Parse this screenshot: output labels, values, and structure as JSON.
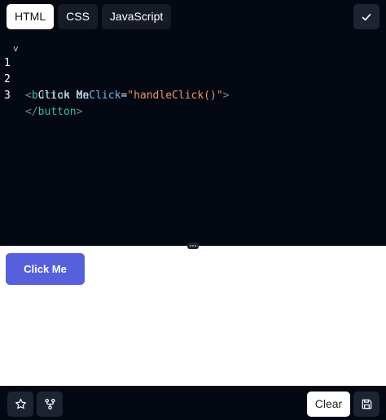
{
  "tabs": [
    {
      "label": "HTML",
      "active": true
    },
    {
      "label": "CSS",
      "active": false
    },
    {
      "label": "JavaScript",
      "active": false
    }
  ],
  "editor": {
    "lines": [
      {
        "number": "1",
        "fold": "v"
      },
      {
        "number": "2",
        "text": "  Click Me"
      },
      {
        "number": "3"
      }
    ],
    "line1": {
      "open": "<",
      "tag": "button",
      "attr": "onClick",
      "eq": "=",
      "value": "\"handleClick()\"",
      "close": ">"
    },
    "line3": {
      "open": "</",
      "tag": "button",
      "close": ">"
    }
  },
  "preview": {
    "button_label": "Click Me"
  },
  "toolbar": {
    "clear_label": "Clear"
  },
  "colors": {
    "editor_bg": "#040812",
    "tab_bg": "#161b27",
    "active_tab_bg": "#ffffff",
    "preview_button_bg": "#5660dd",
    "tag_color": "#3fb8a6",
    "attr_color": "#6fb9f0",
    "string_color": "#e9946a"
  },
  "icons": {
    "confirm": "check-icon",
    "favorite": "star-icon",
    "fork": "fork-icon",
    "save": "save-icon",
    "splitter": "drag-handle-icon"
  }
}
